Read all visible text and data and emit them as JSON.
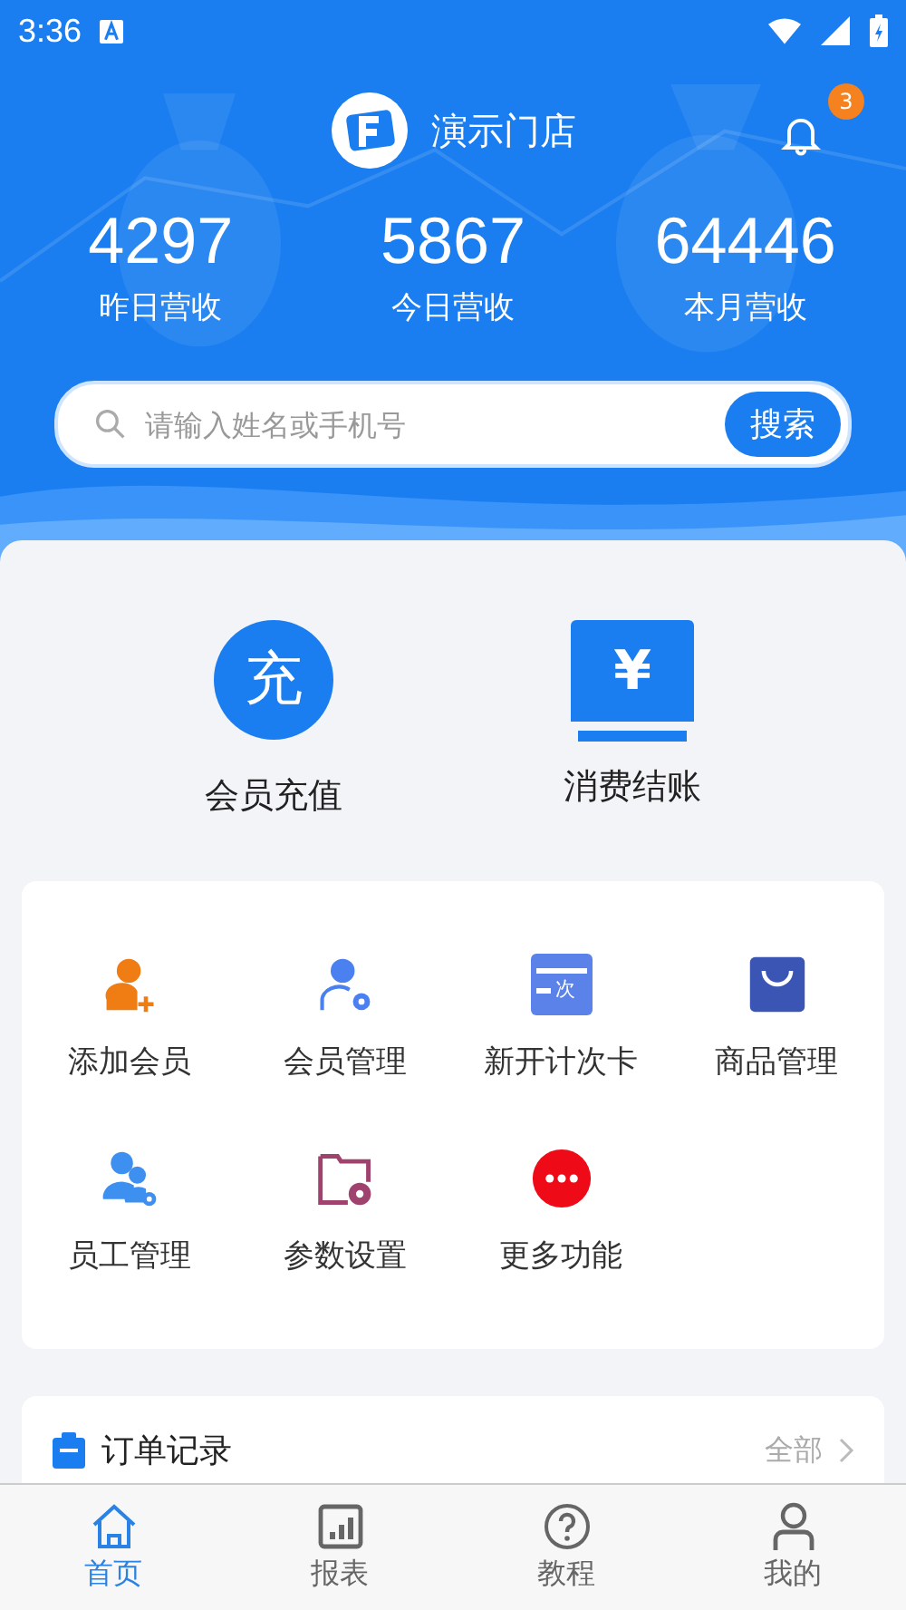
{
  "status_bar": {
    "time": "3:36"
  },
  "header": {
    "store_name": "演示门店",
    "notification_count": "3"
  },
  "stats": [
    {
      "value": "4297",
      "label": "昨日营收"
    },
    {
      "value": "5867",
      "label": "今日营收"
    },
    {
      "value": "64446",
      "label": "本月营收"
    }
  ],
  "search": {
    "placeholder": "请输入姓名或手机号",
    "button": "搜索"
  },
  "quick_actions": [
    {
      "kind": "recharge",
      "icon_text": "充",
      "label": "会员充值"
    },
    {
      "kind": "checkout",
      "icon_text": "¥",
      "label": "消费结账"
    }
  ],
  "functions": [
    {
      "kind": "add-member",
      "label": "添加会员"
    },
    {
      "kind": "member-manage",
      "label": "会员管理"
    },
    {
      "kind": "count-card",
      "icon_text": "次",
      "label": "新开计次卡"
    },
    {
      "kind": "goods",
      "label": "商品管理"
    },
    {
      "kind": "staff",
      "label": "员工管理"
    },
    {
      "kind": "settings",
      "label": "参数设置"
    },
    {
      "kind": "more",
      "label": "更多功能"
    }
  ],
  "orders": {
    "title": "订单记录",
    "link": "全部"
  },
  "tab_bar": [
    {
      "kind": "home",
      "label": "首页",
      "selected": true
    },
    {
      "kind": "report",
      "label": "报表",
      "selected": false
    },
    {
      "kind": "help",
      "label": "教程",
      "selected": false
    },
    {
      "kind": "profile",
      "label": "我的",
      "selected": false
    }
  ]
}
